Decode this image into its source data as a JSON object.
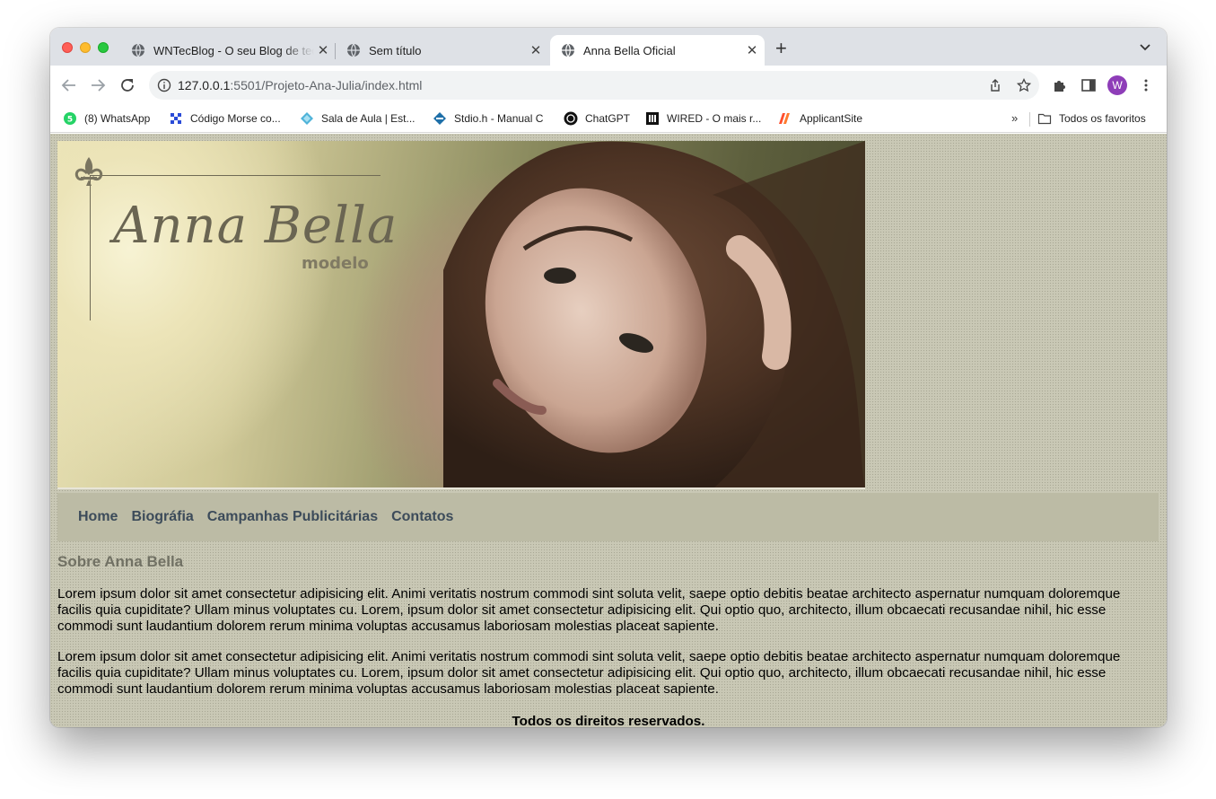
{
  "browser": {
    "tabs": [
      {
        "title": "WNTecBlog - O seu Blog de tecnologia",
        "active": false
      },
      {
        "title": "Sem título",
        "active": false
      },
      {
        "title": "Anna Bella Oficial",
        "active": true
      }
    ],
    "url_host": "127.0.0.1",
    "url_path": ":5501/Projeto-Ana-Julia/index.html",
    "profile_initial": "W",
    "bookmarks": [
      {
        "label": "(8) WhatsApp",
        "icon": "whatsapp-icon"
      },
      {
        "label": "Código Morse co...",
        "icon": "morse-icon"
      },
      {
        "label": "Sala de Aula | Est...",
        "icon": "classroom-icon"
      },
      {
        "label": "Stdio.h - Manual C",
        "icon": "stdio-icon"
      },
      {
        "label": "ChatGPT",
        "icon": "chatgpt-icon"
      },
      {
        "label": "WIRED - O mais r...",
        "icon": "wired-icon"
      },
      {
        "label": "ApplicantSite",
        "icon": "applicant-icon"
      }
    ],
    "all_bookmarks_label": "Todos os favoritos",
    "more_bookmarks": "»"
  },
  "page": {
    "banner": {
      "title": "Anna Bella",
      "subtitle": "modelo"
    },
    "nav": [
      "Home",
      "Biográfia",
      "Campanhas Publicitárias",
      "Contatos"
    ],
    "section_title": "Sobre Anna Bella",
    "paragraphs": [
      "Lorem ipsum dolor sit amet consectetur adipisicing elit. Animi veritatis nostrum commodi sint soluta velit, saepe optio debitis beatae architecto aspernatur numquam doloremque facilis quia cupiditate? Ullam minus voluptates cu. Lorem, ipsum dolor sit amet consectetur adipisicing elit. Qui optio quo, architecto, illum obcaecati recusandae nihil, hic esse commodi sunt laudantium dolorem rerum minima voluptas accusamus laboriosam molestias placeat sapiente.",
      "Lorem ipsum dolor sit amet consectetur adipisicing elit. Animi veritatis nostrum commodi sint soluta velit, saepe optio debitis beatae architecto aspernatur numquam doloremque facilis quia cupiditate? Ullam minus voluptates cu. Lorem, ipsum dolor sit amet consectetur adipisicing elit. Qui optio quo, architecto, illum obcaecati recusandae nihil, hic esse commodi sunt laudantium dolorem rerum minima voluptas accusamus laboriosam molestias placeat sapiente."
    ],
    "footer": "Todos os direitos reservados."
  },
  "colors": {
    "page_bg": "#c9c8b5",
    "nav_bg": "#bcbba5",
    "nav_link": "#3c4b5a",
    "section_title": "#717164"
  }
}
